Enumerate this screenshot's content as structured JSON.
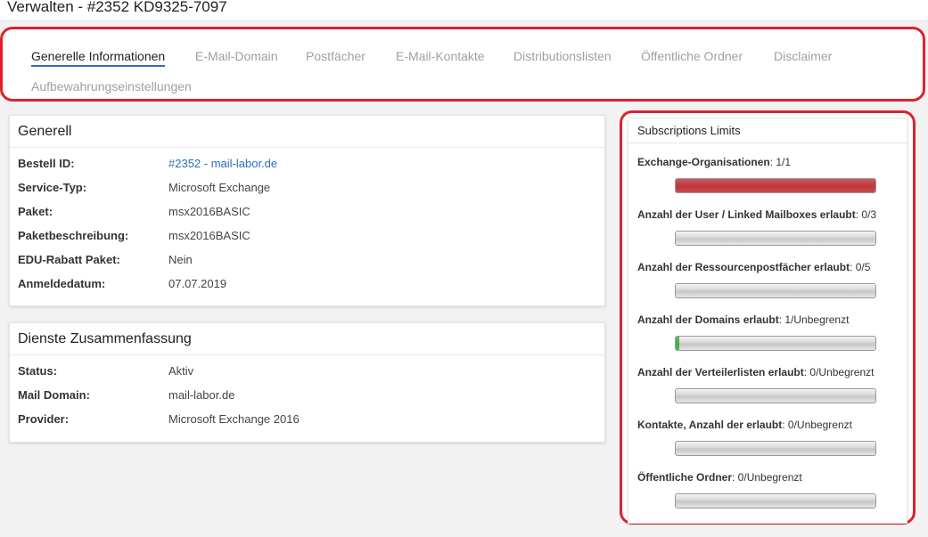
{
  "page": {
    "title": "Verwalten - #2352 KD9325-7097"
  },
  "tabs": [
    {
      "label": "Generelle Informationen",
      "active": true
    },
    {
      "label": "E-Mail-Domain",
      "active": false
    },
    {
      "label": "Postfächer",
      "active": false
    },
    {
      "label": "E-Mail-Kontakte",
      "active": false
    },
    {
      "label": "Distributionslisten",
      "active": false
    },
    {
      "label": "Öffentliche Ordner",
      "active": false
    },
    {
      "label": "Disclaimer",
      "active": false
    },
    {
      "label": "Aufbewahrungseinstellungen",
      "active": false
    }
  ],
  "general": {
    "title": "Generell",
    "rows": [
      {
        "key": "Bestell ID:",
        "value": "#2352 - mail-labor.de",
        "link": true
      },
      {
        "key": "Service-Typ:",
        "value": "Microsoft Exchange"
      },
      {
        "key": "Paket:",
        "value": "msx2016BASIC"
      },
      {
        "key": "Paketbeschreibung:",
        "value": "msx2016BASIC"
      },
      {
        "key": "EDU-Rabatt Paket:",
        "value": "Nein"
      },
      {
        "key": "Anmeldedatum:",
        "value": "07.07.2019"
      }
    ]
  },
  "summary": {
    "title": "Dienste Zusammenfassung",
    "rows": [
      {
        "key": "Status:",
        "value": "Aktiv"
      },
      {
        "key": "Mail Domain:",
        "value": "mail-labor.de"
      },
      {
        "key": "Provider:",
        "value": "Microsoft Exchange 2016"
      }
    ]
  },
  "limits": {
    "title": "Subscriptions Limits",
    "items": [
      {
        "label": "Exchange-Organisationen",
        "value": ": 1/1",
        "fill": 1.0,
        "color": "#c0373b"
      },
      {
        "label": "Anzahl der User / Linked Mailboxes erlaubt",
        "value": ": 0/3",
        "fill": 0,
        "color": "#3cb043"
      },
      {
        "label": "Anzahl der Ressourcenpostfächer erlaubt",
        "value": ": 0/5",
        "fill": 0,
        "color": "#3cb043"
      },
      {
        "label": "Anzahl der Domains erlaubt",
        "value": ": 1/Unbegrenzt",
        "fill": 0.02,
        "color": "#3cb043"
      },
      {
        "label": "Anzahl der Verteilerlisten erlaubt",
        "value": ": 0/Unbegrenzt",
        "fill": 0,
        "color": "#3cb043"
      },
      {
        "label": "Kontakte, Anzahl der erlaubt",
        "value": ": 0/Unbegrenzt",
        "fill": 0,
        "color": "#3cb043"
      },
      {
        "label": "Öffentliche Ordner",
        "value": ": 0/Unbegrenzt",
        "fill": 0,
        "color": "#3cb043"
      }
    ]
  }
}
